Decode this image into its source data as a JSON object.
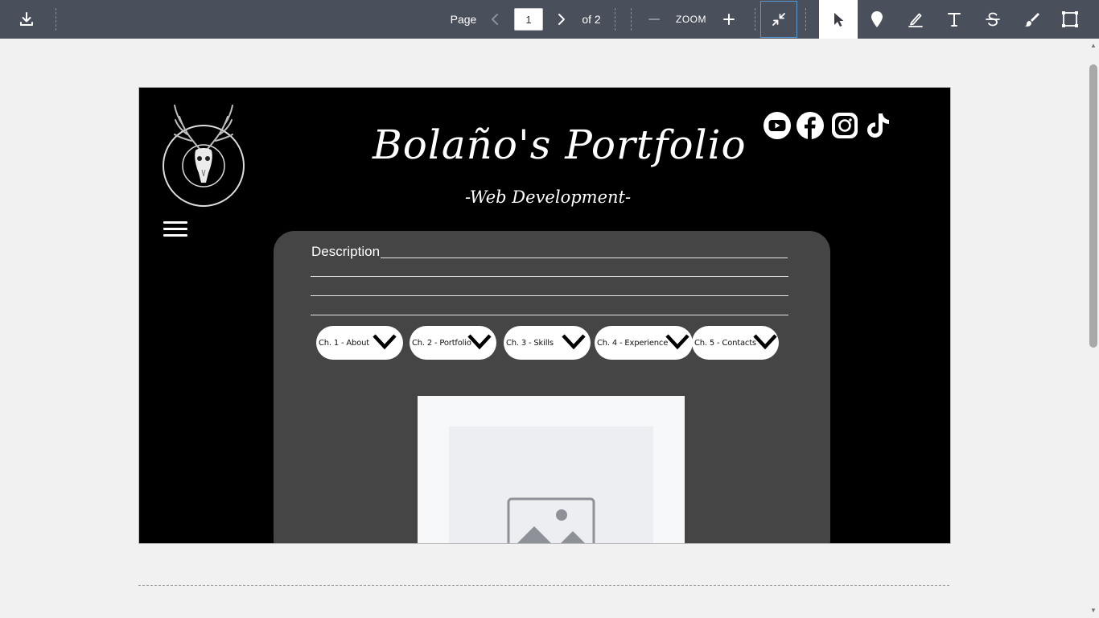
{
  "toolbar": {
    "download_icon": "download-icon",
    "page_label": "Page",
    "page_value": "1",
    "page_total": "of 2",
    "zoom_label": "ZOOM",
    "tools": [
      "select-icon",
      "pin-icon",
      "highlight-icon",
      "text-icon",
      "strikethrough-icon",
      "brush-icon",
      "crop-icon"
    ]
  },
  "document": {
    "title": "Bolaño's Portfolio",
    "subtitle": "-Web Development-",
    "social_icons": [
      "youtube-icon",
      "facebook-icon",
      "instagram-icon",
      "tiktok-icon"
    ],
    "description_label": "Description",
    "chapters": [
      {
        "label": "Ch. 1 - About"
      },
      {
        "label": "Ch. 2 - Portfolio"
      },
      {
        "label": "Ch. 3 - Skills"
      },
      {
        "label": "Ch. 4 - Experience"
      },
      {
        "label": "Ch. 5 - Contacts"
      }
    ]
  },
  "colors": {
    "toolbar_bg": "#4a4f5c",
    "page_bg": "#000000",
    "card_bg": "#454545",
    "accent": "#5b9bd5"
  }
}
